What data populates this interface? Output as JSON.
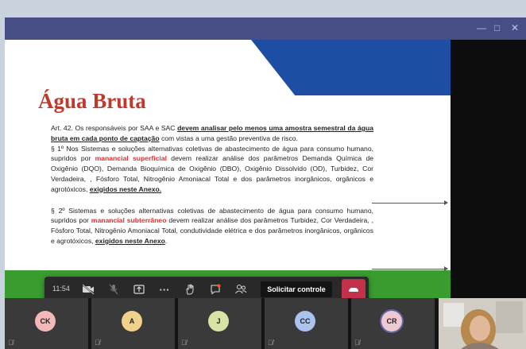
{
  "slide": {
    "title": "Água Bruta",
    "art42": {
      "prefix": "Art. 42. Os responsáveis por SAA e SAC ",
      "emphasis": "devem analisar pelo menos uma amostra semestral da água bruta em cada ponto de captação",
      "suffix": " com vistas a uma gestão preventiva de risco."
    },
    "p1": {
      "prefix": "§ 1º Nos Sistemas e soluções alternativas coletivas de abastecimento de água para consumo humano, supridos por ",
      "highlight": "manancial superficial",
      "middle": " devem realizar análise dos parâmetros Demanda Química de Oxigênio (DQO), Demanda Bioquímica de Oxigênio (DBO), Oxigênio Dissolvido (OD), Turbidez, Cor Verdadeira, , Fósforo Total, Nitrogênio Amoniacal Total e dos parâmetros inorgânicos, orgânicos e agrotóxicos, ",
      "emphasis": "exigidos neste Anexo."
    },
    "p2": {
      "prefix": "§ 2º Sistemas e soluções alternativas coletivas de abastecimento de água para consumo humano, supridos por ",
      "highlight": "manancial subterrâneo",
      "middle": " devem realizar análise dos parâmetros Turbidez, Cor Verdadeira, , Fósforo Total, Nitrogênio Amoniacal Total, condutividade elétrica e dos parâmetros inorgânicos, orgânicos e agrotóxicos, ",
      "emphasis": "exigidos neste Anexo",
      "end": "."
    }
  },
  "toolbar": {
    "time": "11:54",
    "request_control": "Solicitar controle"
  },
  "participants": [
    {
      "initials": "CK",
      "color": "#f3b8b8"
    },
    {
      "initials": "A",
      "color": "#f1d28a"
    },
    {
      "initials": "J",
      "color": "#d8e3a6"
    },
    {
      "initials": "CC",
      "color": "#aac4ef"
    },
    {
      "initials": "CR",
      "color": "#f0c8cf"
    }
  ],
  "colors": {
    "title_bar": "#474d85",
    "slide_title": "#c0392b",
    "slide_blue": "#1d4ea3",
    "slide_green": "#3a9b2f",
    "highlight": "#e03030",
    "hangup": "#c4314b"
  }
}
